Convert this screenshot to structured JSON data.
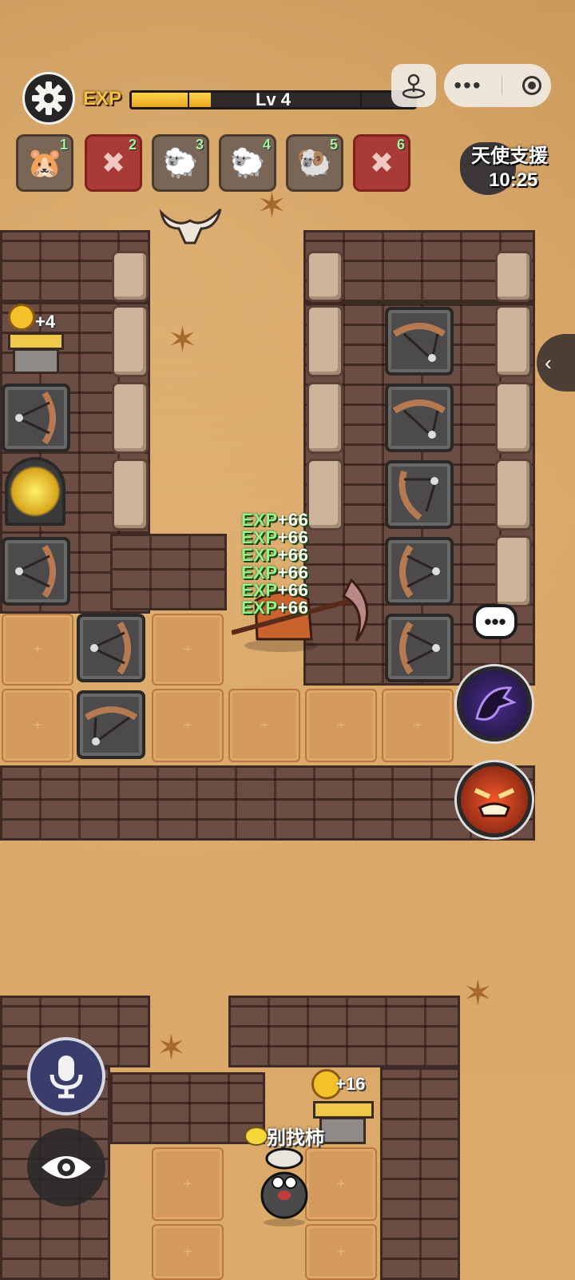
{
  "hud": {
    "exp_label": "EXP",
    "level": "Lv 4",
    "exp_progress": 0.28
  },
  "team": [
    {
      "slot": "1",
      "icon": "hamster-sheep-avatar-icon",
      "state": "normal"
    },
    {
      "slot": "2",
      "icon": "red-claw-demon-avatar-icon",
      "state": "red"
    },
    {
      "slot": "3",
      "icon": "sheep-glasses-avatar-icon",
      "state": "normal"
    },
    {
      "slot": "4",
      "icon": "black-sheep-avatar-icon",
      "state": "normal"
    },
    {
      "slot": "5",
      "icon": "sheep-headband-avatar-icon",
      "state": "normal"
    },
    {
      "slot": "6",
      "icon": "red-claw-demon-avatar-icon",
      "state": "red"
    }
  ],
  "support": {
    "label": "天使支援",
    "timer": "10:25"
  },
  "exp_popups": [
    "+66",
    "+66",
    "+66",
    "+66",
    "+66",
    "+66"
  ],
  "exp_popup_prefix": "EXP",
  "structures": {
    "gold_house_top_gain": "+4",
    "gold_house_bottom_gain": "+16"
  },
  "player": {
    "name": "别找柿"
  },
  "colors": {
    "exp_fill": "#f0b42a",
    "wall": "#6b4d44",
    "sand": "#d9a565"
  }
}
